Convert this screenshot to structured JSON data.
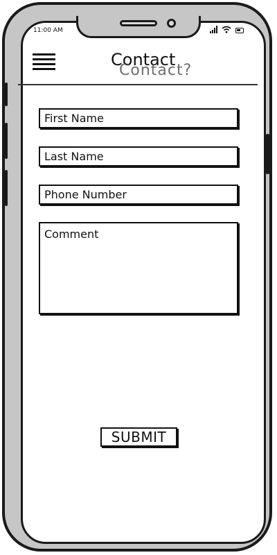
{
  "status_bar": {
    "time": "11:00 AM"
  },
  "header": {
    "title": "Contact",
    "title_echo": "Contact?"
  },
  "form": {
    "first_name_label": "First Name",
    "last_name_label": "Last Name",
    "phone_label": "Phone Number",
    "comment_label": "Comment",
    "submit_label": "SUBMIT"
  },
  "icons": {
    "menu": "hamburger-menu-icon",
    "signal": "signal-icon",
    "wifi": "wifi-icon",
    "battery": "battery-icon"
  }
}
